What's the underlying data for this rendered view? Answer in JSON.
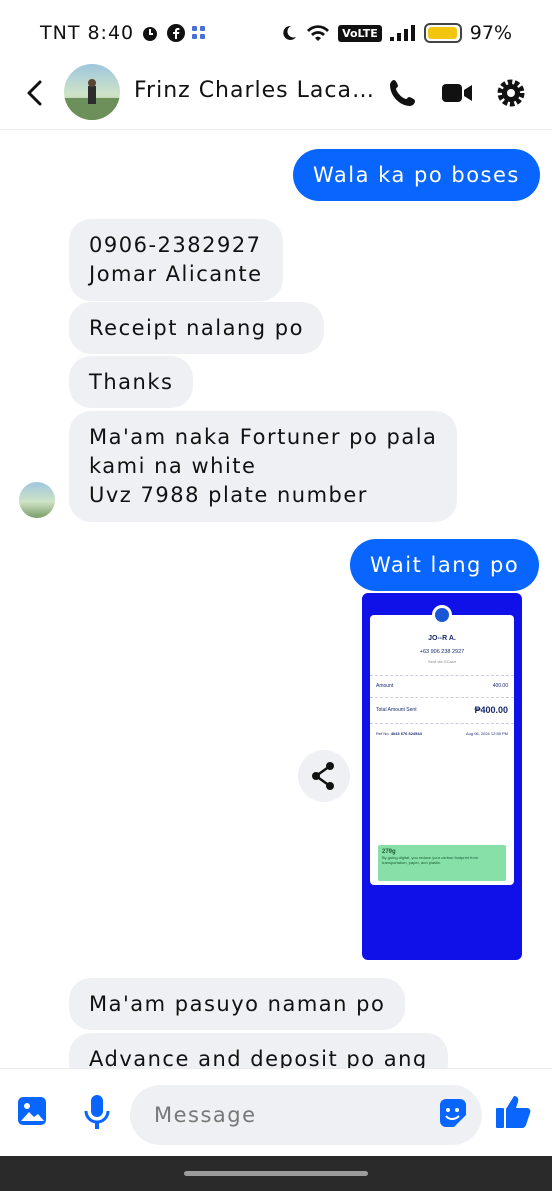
{
  "status_bar": {
    "carrier_time": "TNT 8:40",
    "volte": "VoLTE",
    "battery": "97%",
    "battery_level": 0.97,
    "icons": [
      "alarm-icon",
      "facebook-icon",
      "app-grid-icon",
      "moon-icon",
      "wifi-icon",
      "signal-icon",
      "battery-icon"
    ]
  },
  "header": {
    "contact_name": "Frinz Charles Lacani...",
    "icons": [
      "back-icon",
      "phone-icon",
      "video-icon",
      "settings-icon"
    ]
  },
  "messages": [
    {
      "dir": "out",
      "text": "Wala ka po boses"
    },
    {
      "dir": "in",
      "lines": [
        "0906-2382927",
        "Jomar Alicante"
      ]
    },
    {
      "dir": "in",
      "text": "Receipt nalang po"
    },
    {
      "dir": "in",
      "text": "Thanks"
    },
    {
      "dir": "in",
      "lines": [
        "Ma'am naka Fortuner po pala",
        "kami na white",
        "Uvz 7988 plate number"
      ]
    },
    {
      "dir": "out",
      "text": "Wait lang po"
    },
    {
      "dir": "in",
      "text": "Ma'am pasuyo naman po"
    },
    {
      "dir": "in",
      "text": "Advance and deposit po ang"
    }
  ],
  "receipt": {
    "recipient": "JO--R A.",
    "phone": "+63 906 238 2927",
    "sent_via": "Sent via GCash",
    "amount_label": "Amount",
    "amount_value": "400.00",
    "total_label": "Total Amount Sent",
    "total_value": "₱400.00",
    "ref_label": "Ref No.",
    "ref_value": "4043 676 624544",
    "date": "Aug 06, 2024 12:59 PM",
    "green_title": "279g",
    "green_text": "By going digital, you reduce your carbon footprint from transportation, paper, and plastic."
  },
  "composer": {
    "placeholder": "Message",
    "icons": [
      "gallery-icon",
      "microphone-icon",
      "sticker-icon",
      "like-icon"
    ]
  },
  "colors": {
    "accent": "#0866ff",
    "incoming_bubble": "#eff0f3",
    "receipt_bg": "#1010e8"
  }
}
